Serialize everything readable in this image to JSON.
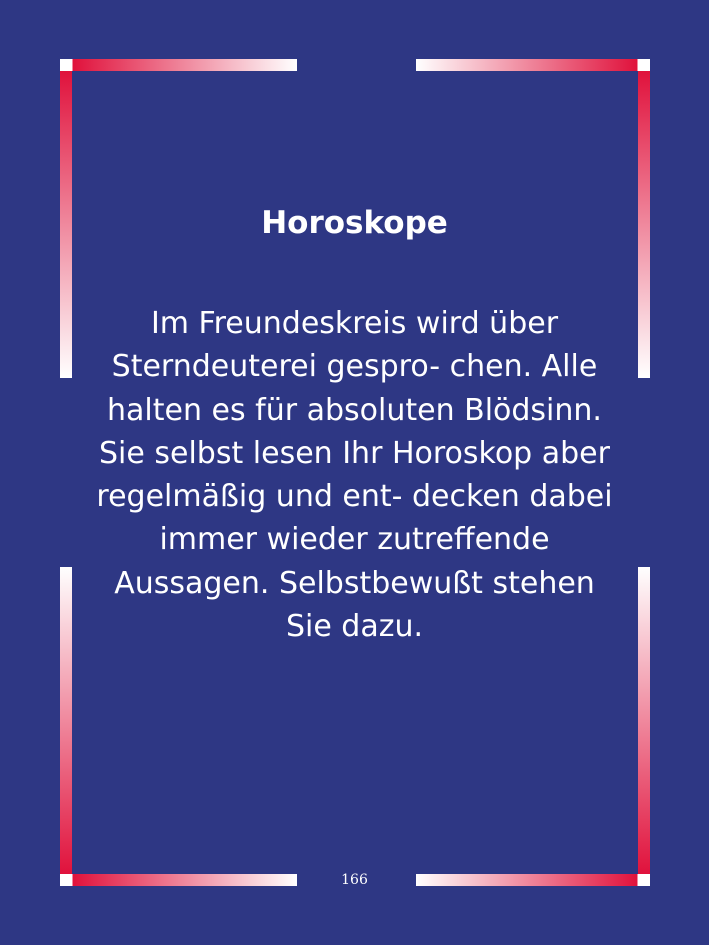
{
  "card": {
    "title": "Horoskope",
    "body": "Im Freundeskreis wird über Sterndeuterei gespro- chen. Alle halten es für absoluten Blödsinn. Sie selbst lesen Ihr Horoskop aber regelmäßig und ent- decken dabei immer wieder zutreffende Aussagen. Selbstbewußt stehen Sie dazu."
  },
  "page_number": "166",
  "colors": {
    "background": "#2e3784",
    "frame_red": "#e0123c",
    "frame_white": "#ffffff",
    "text": "#ffffff"
  }
}
